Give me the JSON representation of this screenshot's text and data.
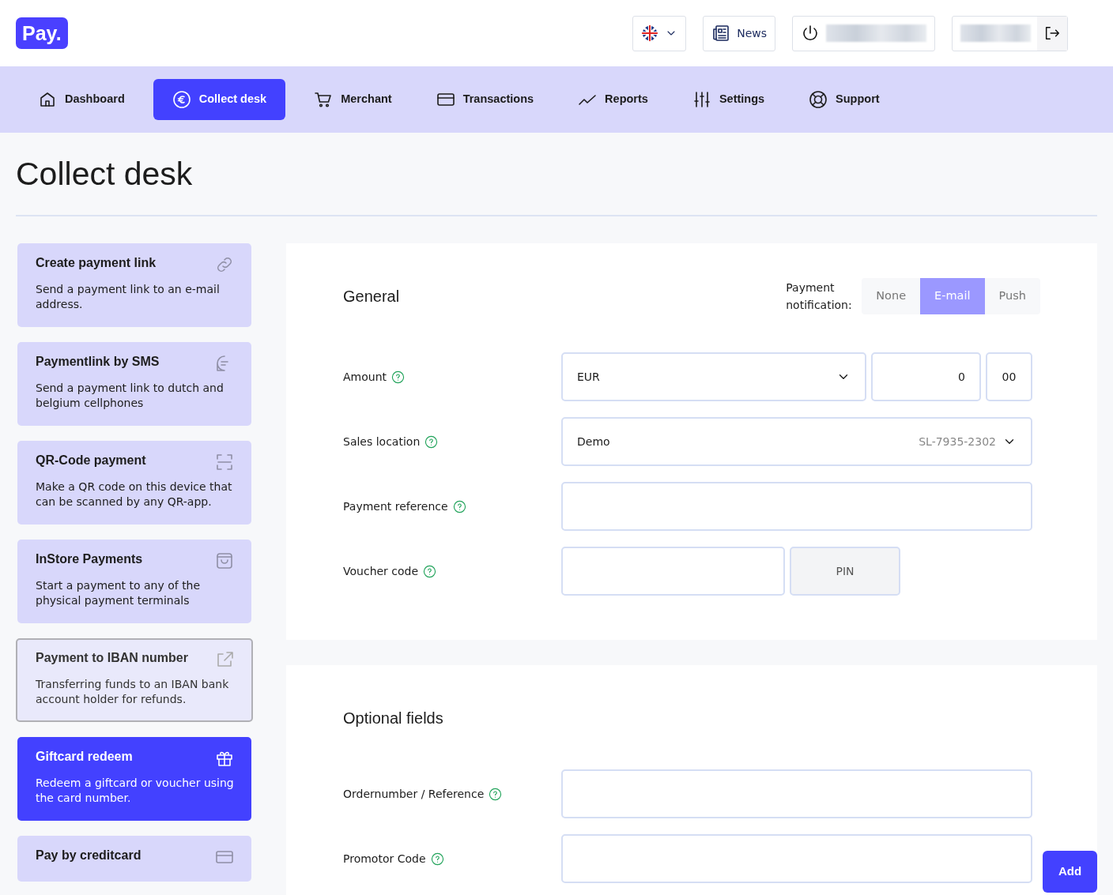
{
  "header": {
    "logo": "Pay.",
    "news_button": "News"
  },
  "nav": [
    {
      "label": "Dashboard",
      "selected": false
    },
    {
      "label": "Collect desk",
      "selected": true
    },
    {
      "label": "Merchant",
      "selected": false
    },
    {
      "label": "Transactions",
      "selected": false
    },
    {
      "label": "Reports",
      "selected": false
    },
    {
      "label": "Settings",
      "selected": false
    },
    {
      "label": "Support",
      "selected": false
    }
  ],
  "page_title": "Collect desk",
  "sidebar": {
    "items": [
      {
        "title": "Create payment link",
        "description": "Send a payment link to an e-mail address.",
        "kind": "action",
        "selected": false
      },
      {
        "title": "Paymentlink by SMS",
        "description": "Send a payment link to dutch and belgium cellphones",
        "kind": "action",
        "selected": false
      },
      {
        "title": "QR-Code payment",
        "description": "Make a QR code on this device that can be scanned by any QR-app.",
        "kind": "action",
        "selected": false
      },
      {
        "title": "InStore Payments",
        "description": "Start a payment to any of the physical payment terminals",
        "kind": "action",
        "selected": false
      },
      {
        "title": "Payment to IBAN number",
        "description": "Transferring funds to an IBAN bank account holder for refunds.",
        "kind": "external",
        "selected": false
      },
      {
        "title": "Giftcard redeem",
        "description": "Redeem a giftcard or voucher using the card number.",
        "kind": "action",
        "selected": true
      },
      {
        "title": "Pay by creditcard",
        "kind": "action",
        "selected": false
      }
    ]
  },
  "general": {
    "title": "General",
    "notification": {
      "label": "Payment notification:",
      "options": [
        {
          "label": "None",
          "selected": false
        },
        {
          "label": "E-mail",
          "selected": true
        },
        {
          "label": "Push",
          "selected": false
        }
      ]
    },
    "rows": [
      {
        "label": "Amount",
        "kind": "amount",
        "currency": "EUR",
        "value": "0",
        "decimals": "00"
      },
      {
        "label": "Sales location",
        "kind": "select",
        "value": "Demo",
        "code": "SL-7935-2302"
      },
      {
        "label": "Payment reference",
        "kind": "text"
      },
      {
        "label": "Voucher code",
        "kind": "voucher",
        "pin_button": "PIN"
      }
    ]
  },
  "optional": {
    "title": "Optional fields",
    "rows": [
      {
        "label": "Ordernumber / Reference",
        "kind": "text"
      },
      {
        "label": "Promotor Code",
        "kind": "text"
      }
    ]
  },
  "add_button": "Add"
}
